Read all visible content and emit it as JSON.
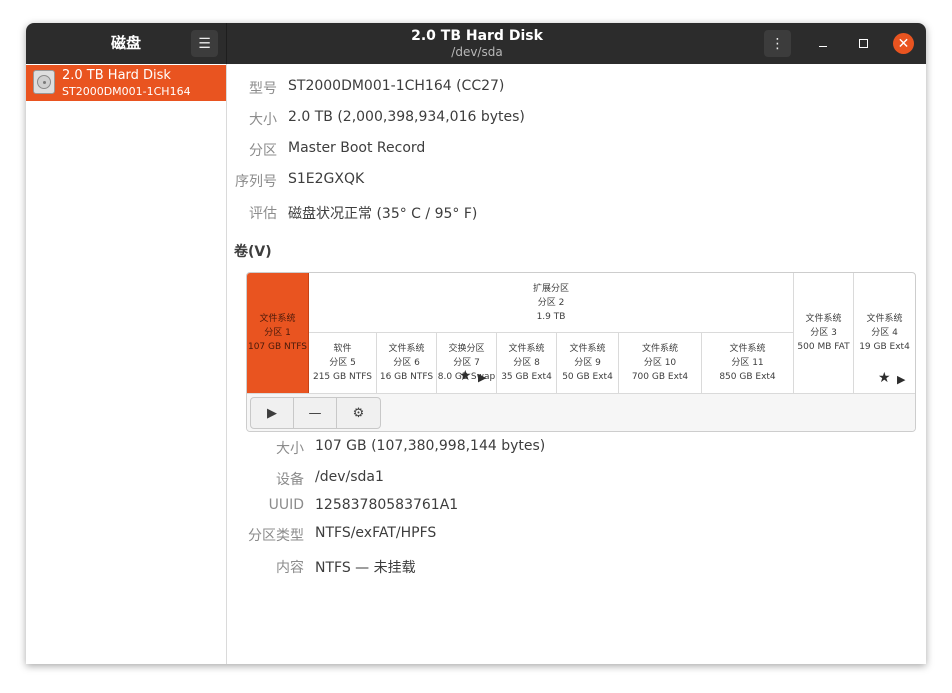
{
  "sidebar": {
    "title": "磁盘",
    "menu_icon": "hamburger-icon",
    "disks": [
      {
        "name": "2.0 TB Hard Disk",
        "model": "ST2000DM001-1CH164",
        "icon": "hard-disk-icon"
      }
    ]
  },
  "header": {
    "title": "2.0 TB Hard Disk",
    "subtitle": "/dev/sda",
    "menu_icon": "kebab-menu-icon",
    "minimize_icon": "minimize-icon",
    "maximize_icon": "maximize-icon",
    "close_icon": "close-icon"
  },
  "disk_properties": [
    {
      "label": "型号",
      "value": "ST2000DM001-1CH164 (CC27)"
    },
    {
      "label": "大小",
      "value": "2.0 TB (2,000,398,934,016 bytes)"
    },
    {
      "label": "分区",
      "value": "Master Boot Record"
    },
    {
      "label": "序列号",
      "value": "S1E2GXQK"
    },
    {
      "label": "评估",
      "value": "磁盘状况正常 (35° C / 95° F)"
    }
  ],
  "volumes_heading": "卷(V)",
  "volume_map": {
    "partition1": {
      "line1": "文件系统",
      "line2": "分区 1",
      "line3": "107 GB NTFS"
    },
    "extended": {
      "line1": "扩展分区",
      "line2": "分区 2",
      "line3": "1.9 TB"
    },
    "partition3": {
      "line1": "文件系统",
      "line2": "分区 3",
      "line3": "500 MB FAT"
    },
    "partition4": {
      "line1": "文件系统",
      "line2": "分区 4",
      "line3": "19 GB Ext4"
    },
    "logical": [
      {
        "line1": "软件",
        "line2": "分区 5",
        "line3": "215 GB NTFS"
      },
      {
        "line1": "文件系统",
        "line2": "分区 6",
        "line3": "16 GB NTFS"
      },
      {
        "line1": "交换分区",
        "line2": "分区 7",
        "line3": "8.0 GB Swap"
      },
      {
        "line1": "文件系统",
        "line2": "分区 8",
        "line3": "35 GB Ext4"
      },
      {
        "line1": "文件系统",
        "line2": "分区 9",
        "line3": "50 GB Ext4"
      },
      {
        "line1": "文件系统",
        "line2": "分区 10",
        "line3": "700 GB Ext4"
      },
      {
        "line1": "文件系统",
        "line2": "分区 11",
        "line3": "850 GB Ext4"
      }
    ],
    "toolbar": {
      "mount_icon": "play-icon",
      "delete_icon": "minus-icon",
      "settings_icon": "gears-icon"
    }
  },
  "partition_details": [
    {
      "label": "大小",
      "value": "107 GB (107,380,998,144 bytes)"
    },
    {
      "label": "设备",
      "value": "/dev/sda1"
    },
    {
      "label": "UUID",
      "value": "12583780583761A1"
    },
    {
      "label": "分区类型",
      "value": "NTFS/exFAT/HPFS"
    },
    {
      "label": "内容",
      "value": "NTFS — 未挂载"
    }
  ],
  "colors": {
    "accent": "#e95420",
    "titlebar": "#2c2c2c"
  }
}
